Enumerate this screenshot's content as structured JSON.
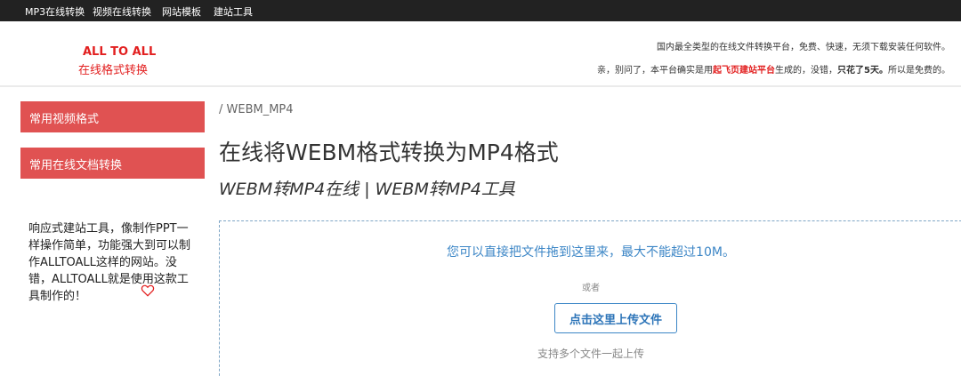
{
  "topnav": {
    "items": [
      {
        "label": "MP3在线转换"
      },
      {
        "label": "视频在线转换"
      },
      {
        "label": "网站模板"
      },
      {
        "label": "建站工具"
      }
    ]
  },
  "header": {
    "logo_line1": "ALL TO ALL",
    "logo_line2": "在线格式转换",
    "tagline1": "国内最全类型的在线文件转换平台，免费、快速，无须下载安装任何软件。",
    "tagline2_a": "亲，别问了，本平台确实是用",
    "tagline2_link": "起飞页建站平台",
    "tagline2_b": "生成的，没错，",
    "tagline2_bold": "只花了5天。",
    "tagline2_c": "所以是免费的。"
  },
  "sidebar": {
    "buttons": [
      {
        "label": "常用视频格式"
      },
      {
        "label": "常用在线文档转换"
      }
    ],
    "promo_text": "响应式建站工具，像制作PPT一样操作简单，功能强大到可以制作ALLTOALL这样的网站。没错，ALLTOALL就是使用这款工具制作的！",
    "heart_icon": "heart-outline-icon"
  },
  "main": {
    "breadcrumb": "/ WEBM_MP4",
    "title": "在线将WEBM格式转换为MP4格式",
    "subtitle": "WEBM转MP4在线 | WEBM转MP4工具",
    "dropzone": {
      "text": "您可以直接把文件拖到这里来，最大不能超过10M。",
      "or": "或者",
      "upload_label": "点击这里上传文件",
      "hint": "支持多个文件一起上传"
    }
  },
  "colors": {
    "accent_red": "#e21f1f",
    "sidebar_button": "#e05252",
    "link_blue": "#3c86c6",
    "topbar": "#222222"
  }
}
